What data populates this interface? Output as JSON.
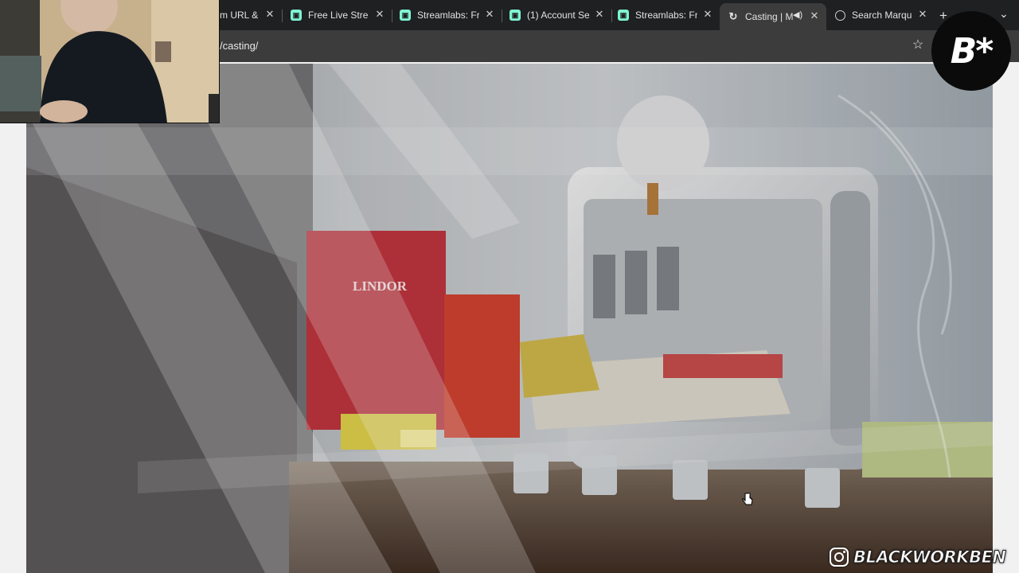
{
  "browser": {
    "tabs": [
      {
        "label": "m URL &",
        "icon": "link-icon",
        "icon_color": "#2b2b2b"
      },
      {
        "label": "Free Live Stre",
        "icon": "streamlabs-icon",
        "icon_color": "#80f5d2"
      },
      {
        "label": "Streamlabs: Fr",
        "icon": "streamlabs-icon",
        "icon_color": "#80f5d2"
      },
      {
        "label": "(1) Account Se",
        "icon": "streamlabs-icon",
        "icon_color": "#80f5d2"
      },
      {
        "label": "Streamlabs: Fr",
        "icon": "streamlabs-icon",
        "icon_color": "#80f5d2"
      },
      {
        "label": "Casting | M",
        "icon": "loading-icon",
        "icon_color": "#e3e3e3",
        "active": true,
        "audio": true
      },
      {
        "label": "Search Marqu",
        "icon": "globe-icon",
        "icon_color": "#e3e3e3"
      }
    ],
    "close_glyph": "✕",
    "new_tab_glyph": "+",
    "audio_glyph": "🔊",
    "tab_list_glyph": "⌄",
    "url": "/casting/",
    "bookmark_glyph": "☆"
  },
  "overlay": {
    "logo_text": "B*",
    "watermark_text": "BLACKWORKBEN",
    "watermark_icon": "instagram-icon"
  },
  "colors": {
    "chrome_bg": "#1f2021",
    "active_tab": "#3c3c3c",
    "page_bg": "#f1f1f1",
    "streamlabs": "#80f5d2"
  }
}
